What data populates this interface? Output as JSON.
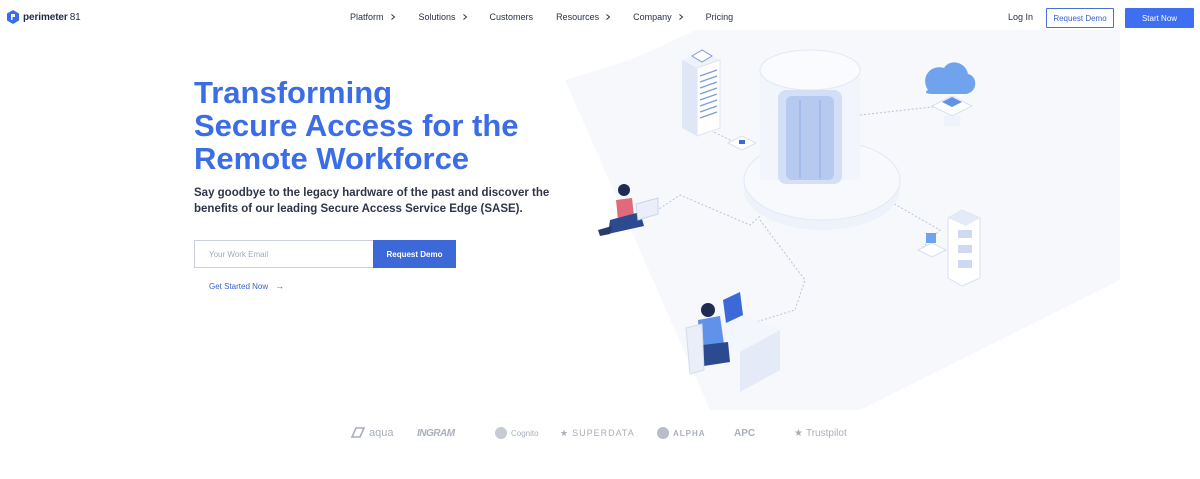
{
  "brand": {
    "name": "perimeter",
    "number": "81",
    "color": "#3b6ee6"
  },
  "nav": {
    "items": [
      {
        "label": "Platform",
        "has_chevron": true
      },
      {
        "label": "Solutions",
        "has_chevron": true
      },
      {
        "label": "Customers",
        "has_chevron": false
      },
      {
        "label": "Resources",
        "has_chevron": true
      },
      {
        "label": "Company",
        "has_chevron": true
      },
      {
        "label": "Pricing",
        "has_chevron": false
      }
    ],
    "login": "Log In",
    "request_demo": "Request Demo",
    "start_now": "Start Now"
  },
  "hero": {
    "title_lines": [
      "Transforming",
      "Secure Access for the",
      "Remote Workforce"
    ],
    "subtitle": "Say goodbye to the legacy hardware of the past and discover the benefits of our leading Secure Access Service Edge (SASE).",
    "email_placeholder": "Your Work Email",
    "email_value": "",
    "cta_button": "Request Demo",
    "get_started": "Get Started Now",
    "get_started_arrow": "→"
  },
  "partner_logos": [
    {
      "name": "aqua",
      "icon": "aqua-logo-icon"
    },
    {
      "name": "INGRAM",
      "icon": "ingram-logo-icon"
    },
    {
      "name": "Cognito",
      "icon": "cognito-logo-icon"
    },
    {
      "name": "SUPERDATA",
      "icon": "superdata-logo-icon"
    },
    {
      "name": "ALPHA",
      "icon": "alpha-logo-icon"
    },
    {
      "name": "APC",
      "icon": "apc-logo-icon"
    },
    {
      "name": "Trustpilot",
      "icon": "trustpilot-star-icon"
    }
  ],
  "colors": {
    "accent": "#3d6ff0",
    "title": "#3b6ee6",
    "text": "#2f3548",
    "logo_gray": "#a9afba"
  }
}
